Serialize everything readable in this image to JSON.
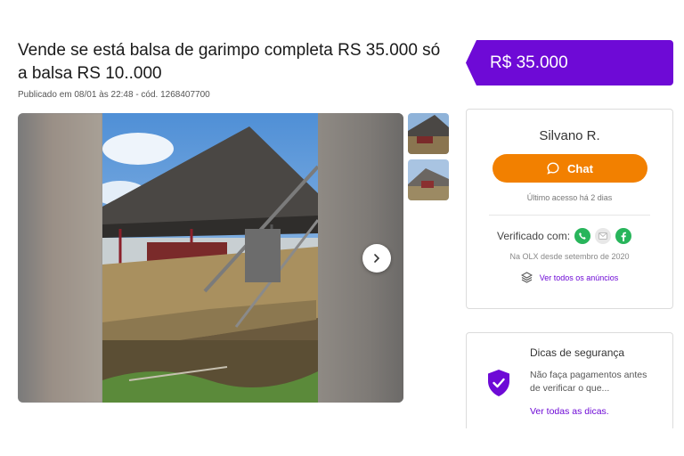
{
  "listing": {
    "title": "Vende se está balsa de garimpo completa RS 35.000 só a balsa RS 10..000",
    "meta": "Publicado em 08/01 às 22:48 - cód. 1268407700",
    "price": "R$ 35.000"
  },
  "gallery": {
    "next_icon": "chevron-right-icon",
    "thumbnail_count": 2
  },
  "seller": {
    "name": "Silvano R.",
    "chat_label": "Chat",
    "last_access": "Último acesso há 2 dias",
    "verified_label": "Verificado com:",
    "verified_icons": [
      "phone-icon",
      "email-icon",
      "facebook-icon"
    ],
    "since": "Na OLX desde setembro de 2020",
    "all_ads_label": "Ver todos os anúncios"
  },
  "safety": {
    "title": "Dicas de segurança",
    "text": "Não faça pagamentos antes de verificar o que...",
    "link": "Ver todas as dicas."
  },
  "colors": {
    "brand_purple": "#6e0ad6",
    "chat_orange": "#f28000",
    "verified_green": "#28b55b"
  }
}
